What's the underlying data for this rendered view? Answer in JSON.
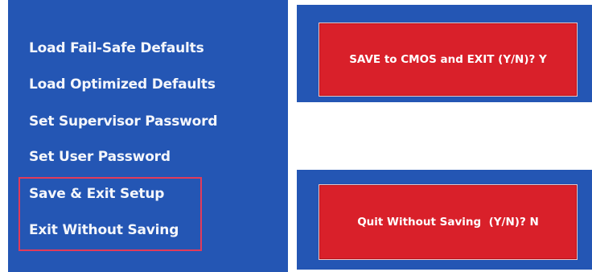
{
  "menu": {
    "items": [
      {
        "label": "Load Fail-Safe Defaults"
      },
      {
        "label": "Load Optimized Defaults"
      },
      {
        "label": "Set Supervisor Password"
      },
      {
        "label": "Set User Password"
      },
      {
        "label": "Save & Exit Setup"
      },
      {
        "label": "Exit Without Saving"
      }
    ]
  },
  "dialogs": {
    "save_exit": {
      "prompt": "SAVE to CMOS and EXIT (Y/N)? Y"
    },
    "quit_no_save": {
      "prompt": "Quit Without Saving  (Y/N)? N"
    }
  },
  "colors": {
    "panel_background": "#2456b4",
    "dialog_background": "#d9202a",
    "highlight_border": "#e23b5a",
    "text": "#ffffff"
  }
}
